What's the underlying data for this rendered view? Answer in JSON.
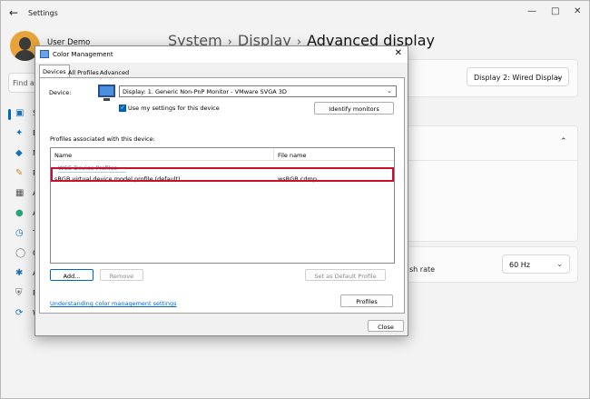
{
  "settings": {
    "app_title": "Settings",
    "user_name": "User Demo",
    "search_placeholder": "Find a",
    "breadcrumb": {
      "part1": "System",
      "part2": "Display",
      "current": "Advanced display"
    },
    "display_select": "Display 2: Wired Display",
    "refresh_label": "sh rate",
    "refresh_value": "60 Hz",
    "nav_items": [
      {
        "letter": "S",
        "icon": "monitor-icon"
      },
      {
        "letter": "B",
        "icon": "bluetooth-icon"
      },
      {
        "letter": "N",
        "icon": "network-icon"
      },
      {
        "letter": "P",
        "icon": "brush-icon"
      },
      {
        "letter": "A",
        "icon": "apps-icon"
      },
      {
        "letter": "A",
        "icon": "accounts-icon"
      },
      {
        "letter": "T",
        "icon": "time-language-icon"
      },
      {
        "letter": "G",
        "icon": "gaming-icon"
      },
      {
        "letter": "A",
        "icon": "accessibility-icon"
      },
      {
        "letter": "P",
        "icon": "privacy-shield-icon"
      },
      {
        "letter": "W",
        "icon": "windows-update-icon"
      }
    ]
  },
  "dialog": {
    "title": "Color Management",
    "tabs": [
      "Devices",
      "All Profiles",
      "Advanced"
    ],
    "device_label": "Device:",
    "device_value": "Display: 1. Generic Non-PnP Monitor - VMware SVGA 3D",
    "use_settings_label": "Use my settings for this device",
    "identify_button": "Identify monitors",
    "profiles_label": "Profiles associated with this device:",
    "columns": {
      "name": "Name",
      "file": "File name"
    },
    "group_label": "WCS Device Profiles",
    "profiles": [
      {
        "name": "sRGB virtual device model profile (default)",
        "file": "wsRGB.cdmp"
      }
    ],
    "add_button": "Add...",
    "remove_button": "Remove",
    "set_default_button": "Set as Default Profile",
    "link_text": "Understanding color management settings",
    "profiles_button": "Profiles",
    "close_button": "Close"
  },
  "colors": {
    "accent": "#0067c0",
    "highlight_border": "#c8102e",
    "link": "#0066cc"
  }
}
